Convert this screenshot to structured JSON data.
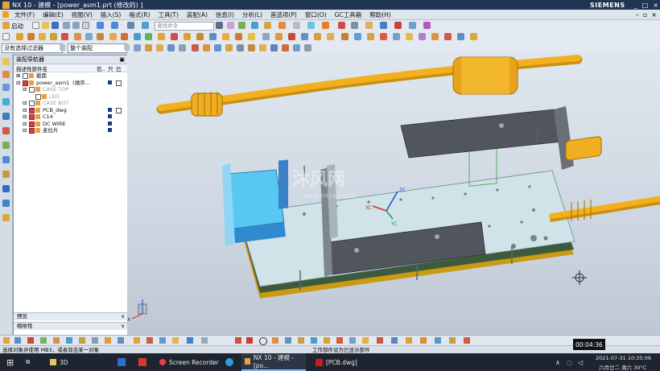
{
  "window": {
    "title": "NX 10 - 建模 - [power_asm1.prt  (修改的)  ]",
    "brand": "SIEMENS",
    "controls": [
      "_",
      "□",
      "×"
    ]
  },
  "menu": {
    "items": [
      "文件(F)",
      "编辑(E)",
      "视图(V)",
      "插入(S)",
      "格式(R)",
      "工具(T)",
      "装配(A)",
      "信息(I)",
      "分析(L)",
      "首选项(P)",
      "窗口(O)",
      "GC工具箱",
      "帮助(H)"
    ]
  },
  "toolbar": {
    "start_label": "启动",
    "search_placeholder": "查找命令",
    "filter_value": "没有选择过滤器",
    "scope_value": "整个装配"
  },
  "navigator": {
    "title": "装配导航器",
    "col_name": "描述性部件名",
    "col_info": "信..",
    "col_r": "只",
    "col_s": "已",
    "rows": [
      {
        "name": "截面",
        "level": 0,
        "checked": false,
        "gray": false
      },
      {
        "name": "power_asm1（顺序...",
        "level": 0,
        "checked": true,
        "gray": false
      },
      {
        "name": "CASE TOP",
        "level": 1,
        "checked": false,
        "gray": true
      },
      {
        "name": "LED",
        "level": 2,
        "checked": false,
        "gray": true
      },
      {
        "name": "CASE BOT",
        "level": 1,
        "checked": false,
        "gray": true
      },
      {
        "name": "PCB_dwg",
        "level": 1,
        "checked": true,
        "gray": false
      },
      {
        "name": "C14",
        "level": 1,
        "checked": true,
        "gray": false
      },
      {
        "name": "DC WIRE",
        "level": 1,
        "checked": true,
        "gray": false
      },
      {
        "name": "麦拉片",
        "level": 1,
        "checked": true,
        "gray": false
      }
    ],
    "preview_label": "预览",
    "deps_label": "相依性"
  },
  "viewport": {
    "watermark_text": "沐风网",
    "watermark_url": "www.mfcad.com",
    "axis_zc": "ZC",
    "axis_xc": "XC",
    "axis_yc": "YC",
    "triad_x": "X"
  },
  "status": {
    "left": "选择对象并使用 MB3，或者双击某一对象",
    "center": "工作部件设为已显示部件"
  },
  "taskbar": {
    "apps": [
      "3D",
      "Screen Recorder",
      "NX 10 - 建模 - [po...",
      "[PCB.dwg]"
    ],
    "recorder_time": "00:04:36",
    "date": "2021-07-31 10:35:06",
    "weather": "六月廿二 周六 30°C"
  },
  "colors": {
    "title_bg": "#1f3553",
    "wire": "#f2b01e",
    "board": "#cfe3e8",
    "case_dark": "#4a4f54",
    "cyan_part": "#4fc3f0",
    "accent": "#d64040"
  }
}
